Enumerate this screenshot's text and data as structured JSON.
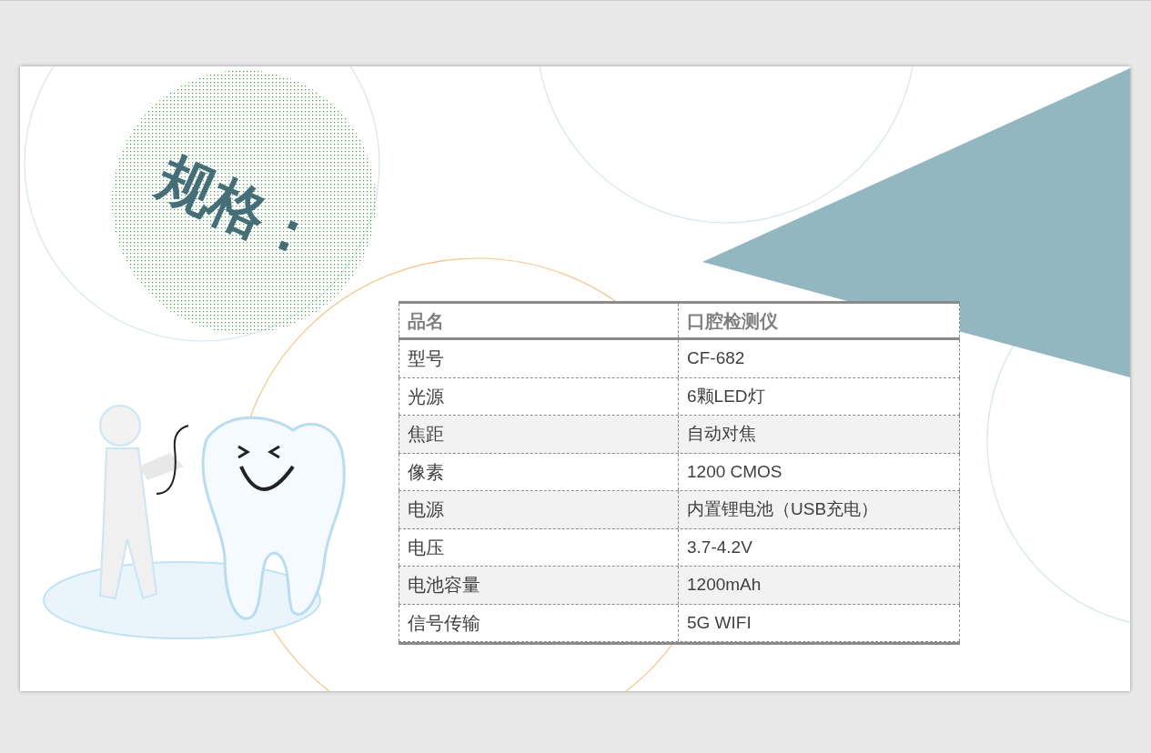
{
  "slide": {
    "title": "规格：",
    "table": {
      "header": [
        "品名",
        "口腔检测仪"
      ],
      "rows": [
        {
          "label": "型号",
          "value": "CF-682"
        },
        {
          "label": "光源",
          "value": "6颗LED灯"
        },
        {
          "label": "焦距",
          "value": "自动对焦"
        },
        {
          "label": "像素",
          "value": "1200  CMOS"
        },
        {
          "label": "电源",
          "value": "内置锂电池（USB充电）"
        },
        {
          "label": "电压",
          "value": "3.7-4.2V"
        },
        {
          "label": "电池容量",
          "value": "1200mAh"
        },
        {
          "label": "信号传输",
          "value": "5G WIFI"
        }
      ]
    }
  }
}
